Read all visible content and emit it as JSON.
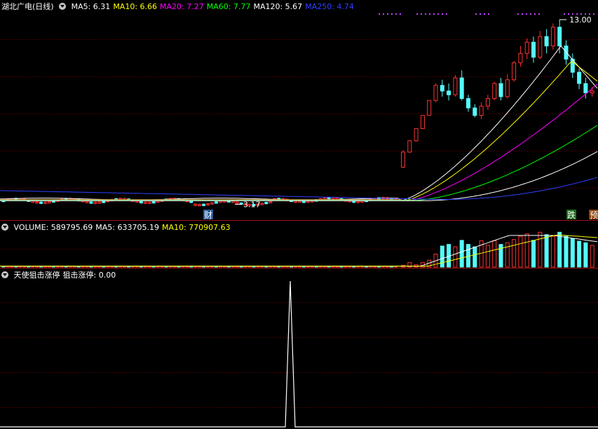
{
  "main": {
    "title": "湖北广电(日线)",
    "ma_labels": [
      {
        "text": "MA5: 6.31",
        "color": "#ffffff"
      },
      {
        "text": "MA10: 6.66",
        "color": "#ffff00"
      },
      {
        "text": "MA20: 7.27",
        "color": "#ff00ff"
      },
      {
        "text": "MA60: 7.77",
        "color": "#00ff00"
      },
      {
        "text": "MA120: 5.67",
        "color": "#ffffff"
      },
      {
        "text": "MA250: 4.74",
        "color": "#3040ff"
      }
    ],
    "high_label": "13.00",
    "low_label": "3.17",
    "tags": [
      {
        "text": "财",
        "color": "#ffffff",
        "bg": "#2a5a9a"
      },
      {
        "text": "跌",
        "color": "#ffffff",
        "bg": "#1a6a1a"
      },
      {
        "text": "预",
        "color": "#ffffff",
        "bg": "#8a3a00"
      }
    ]
  },
  "volume": {
    "labels": [
      {
        "text": "VOLUME: 589795.69",
        "color": "#ffffff"
      },
      {
        "text": "MA5: 633705.19",
        "color": "#ffffff"
      },
      {
        "text": "MA10: 770907.63",
        "color": "#ffff00"
      }
    ]
  },
  "indicator": {
    "labels": [
      {
        "text": "天使狙击涨停",
        "color": "#ffffff"
      },
      {
        "text": "狙击涨停: 0.00",
        "color": "#ffffff"
      }
    ]
  },
  "colors": {
    "up": "#ff3232",
    "down": "#54fcfc",
    "grid": "#800000",
    "separator": "#a01010"
  },
  "chart_data": [
    {
      "type": "candlestick",
      "title": "湖北广电(日线)",
      "ylim": [
        3.0,
        13.3
      ],
      "visible_extremes": {
        "high": 13.0,
        "low": 3.17
      },
      "series_latest": {
        "MA5": 6.31,
        "MA10": 6.66,
        "MA20": 7.27,
        "MA60": 7.77,
        "MA120": 5.67,
        "MA250": 4.74
      },
      "candles": [
        {
          "o": 5.15,
          "c": 5.95,
          "h": 6.05,
          "l": 5.1
        },
        {
          "o": 5.95,
          "c": 6.55,
          "h": 6.6,
          "l": 5.9
        },
        {
          "o": 6.55,
          "c": 7.2,
          "h": 7.2,
          "l": 6.5
        },
        {
          "o": 7.2,
          "c": 7.9,
          "h": 7.9,
          "l": 7.2
        },
        {
          "o": 7.9,
          "c": 8.7,
          "h": 8.7,
          "l": 7.9
        },
        {
          "o": 8.7,
          "c": 9.5,
          "h": 9.6,
          "l": 8.6
        },
        {
          "o": 9.5,
          "c": 9.2,
          "h": 9.8,
          "l": 8.9
        },
        {
          "o": 9.2,
          "c": 9.0,
          "h": 9.6,
          "l": 8.7
        },
        {
          "o": 9.0,
          "c": 9.9,
          "h": 10.05,
          "l": 8.9
        },
        {
          "o": 9.9,
          "c": 8.8,
          "h": 10.3,
          "l": 8.7
        },
        {
          "o": 8.8,
          "c": 8.3,
          "h": 9.0,
          "l": 8.1
        },
        {
          "o": 8.3,
          "c": 7.9,
          "h": 8.5,
          "l": 7.8
        },
        {
          "o": 7.9,
          "c": 8.4,
          "h": 8.6,
          "l": 7.7
        },
        {
          "o": 8.4,
          "c": 8.8,
          "h": 9.0,
          "l": 8.2
        },
        {
          "o": 8.8,
          "c": 9.6,
          "h": 9.7,
          "l": 8.7
        },
        {
          "o": 9.6,
          "c": 8.9,
          "h": 9.9,
          "l": 8.7
        },
        {
          "o": 8.9,
          "c": 9.8,
          "h": 10.1,
          "l": 8.8
        },
        {
          "o": 9.8,
          "c": 10.7,
          "h": 10.8,
          "l": 9.7
        },
        {
          "o": 10.7,
          "c": 11.2,
          "h": 11.6,
          "l": 10.5
        },
        {
          "o": 11.2,
          "c": 11.8,
          "h": 12.0,
          "l": 10.9
        },
        {
          "o": 11.8,
          "c": 11.0,
          "h": 12.1,
          "l": 10.7
        },
        {
          "o": 11.0,
          "c": 12.1,
          "h": 12.4,
          "l": 10.9
        },
        {
          "o": 12.1,
          "c": 11.6,
          "h": 12.5,
          "l": 11.2
        },
        {
          "o": 11.6,
          "c": 12.6,
          "h": 12.8,
          "l": 11.4
        },
        {
          "o": 12.6,
          "c": 11.6,
          "h": 13.0,
          "l": 11.2
        },
        {
          "o": 11.6,
          "c": 10.9,
          "h": 11.9,
          "l": 10.6
        },
        {
          "o": 10.9,
          "c": 10.2,
          "h": 11.2,
          "l": 9.9
        },
        {
          "o": 10.2,
          "c": 9.6,
          "h": 10.4,
          "l": 9.3
        },
        {
          "o": 9.6,
          "c": 9.1,
          "h": 9.9,
          "l": 8.8
        },
        {
          "o": 9.1,
          "c": 9.2,
          "h": 9.4,
          "l": 8.9
        }
      ]
    },
    {
      "type": "bar",
      "title": "VOLUME",
      "ylim": [
        0,
        900000
      ],
      "series_latest": {
        "VOLUME": 589795.69,
        "MA5": 633705.19,
        "MA10": 770907.63
      },
      "values": [
        45000,
        110000,
        60000,
        110000,
        170000,
        320000,
        520000,
        560000,
        500000,
        660000,
        560000,
        500000,
        650000,
        540000,
        650000,
        560000,
        600000,
        680000,
        760000,
        820000,
        660000,
        860000,
        800000,
        760000,
        860000,
        760000,
        700000,
        640000,
        600000,
        540000
      ]
    },
    {
      "type": "line",
      "title": "天使狙击涨停",
      "series_latest": {
        "狙击涨停": 0.0
      },
      "ylim": [
        0,
        1
      ],
      "spike": {
        "value": 1,
        "others": 0
      }
    }
  ]
}
